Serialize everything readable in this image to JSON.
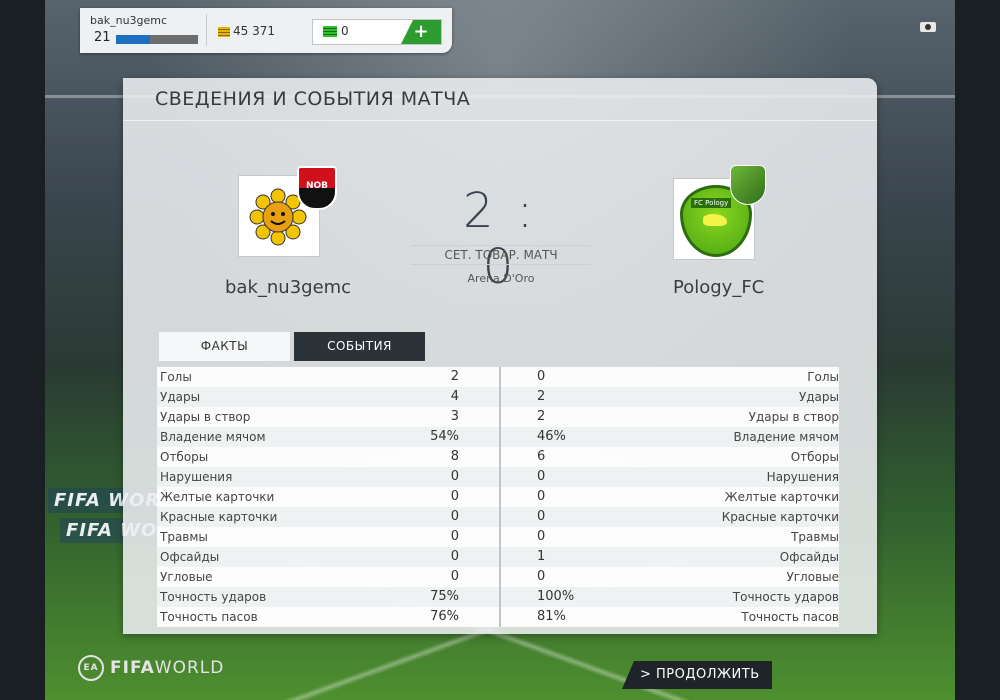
{
  "topbar": {
    "username": "bak_nu3gemc",
    "level": "21",
    "xp_fraction": 0.42,
    "coins": "45 371",
    "points": "0",
    "add_label": "+"
  },
  "panel": {
    "title": "СВЕДЕНИЯ И СОБЫТИЯ МАТЧА"
  },
  "match": {
    "home_team": "bak_nu3gemc",
    "away_team": "Pology_FC",
    "score": "2 : 0",
    "match_type": "СЕТ. ТОВАР. МАТЧ",
    "arena": "Arena D'Oro"
  },
  "tabs": {
    "facts": "ФАКТЫ",
    "events": "СОБЫТИЯ"
  },
  "stats": [
    {
      "label": "Голы",
      "home": "2",
      "away": "0"
    },
    {
      "label": "Удары",
      "home": "4",
      "away": "2"
    },
    {
      "label": "Удары в створ",
      "home": "3",
      "away": "2"
    },
    {
      "label": "Владение мячом",
      "home": "54%",
      "away": "46%"
    },
    {
      "label": "Отборы",
      "home": "8",
      "away": "6"
    },
    {
      "label": "Нарушения",
      "home": "0",
      "away": "0"
    },
    {
      "label": "Желтые карточки",
      "home": "0",
      "away": "0"
    },
    {
      "label": "Красные карточки",
      "home": "0",
      "away": "0"
    },
    {
      "label": "Травмы",
      "home": "0",
      "away": "0"
    },
    {
      "label": "Офсайды",
      "home": "0",
      "away": "1"
    },
    {
      "label": "Угловые",
      "home": "0",
      "away": "0"
    },
    {
      "label": "Точность ударов",
      "home": "75%",
      "away": "100%"
    },
    {
      "label": "Точность пасов",
      "home": "76%",
      "away": "81%"
    }
  ],
  "footer": {
    "brand_bold": "FIFA",
    "brand_light": "WORLD",
    "continue_label": "> ПРОДОЛЖИТЬ"
  },
  "ads": {
    "board1": "FIFA WORLD",
    "board2": "FIFA WORLD"
  },
  "badges": {
    "home_badge_text": "NOB",
    "away_badge_text": "FC Pology"
  },
  "colors": {
    "xp_bar": "#1f6fc0",
    "add_button": "#2d9b2d",
    "events_tab": "#2b3338"
  }
}
